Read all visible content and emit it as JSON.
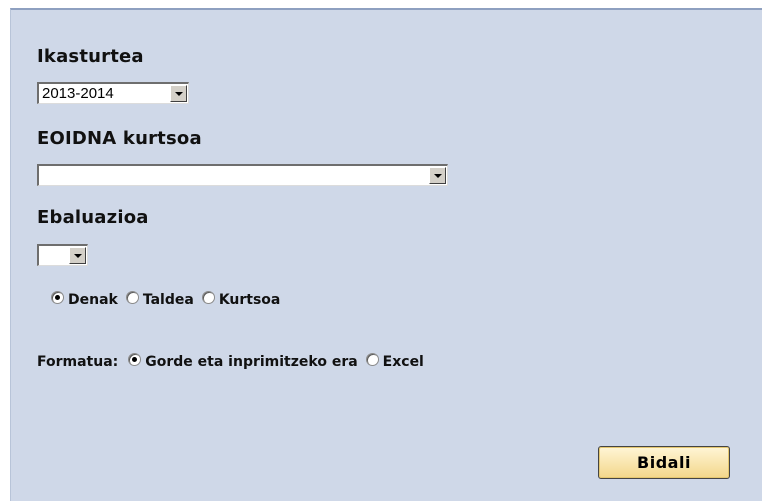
{
  "form": {
    "year_label": "Ikasturtea",
    "year_value": "2013-2014",
    "course_label": "EOIDNA kurtsoa",
    "course_value": "",
    "eval_label": "Ebaluazioa",
    "eval_value": "",
    "scope_options": [
      {
        "label": "Denak",
        "checked": true
      },
      {
        "label": "Taldea",
        "checked": false
      },
      {
        "label": "Kurtsoa",
        "checked": false
      }
    ],
    "format_label": "Formatua:",
    "format_options": [
      {
        "label": "Gorde eta inprimitzeko era",
        "checked": true
      },
      {
        "label": "Excel",
        "checked": false
      }
    ],
    "submit_label": "Bidali"
  }
}
